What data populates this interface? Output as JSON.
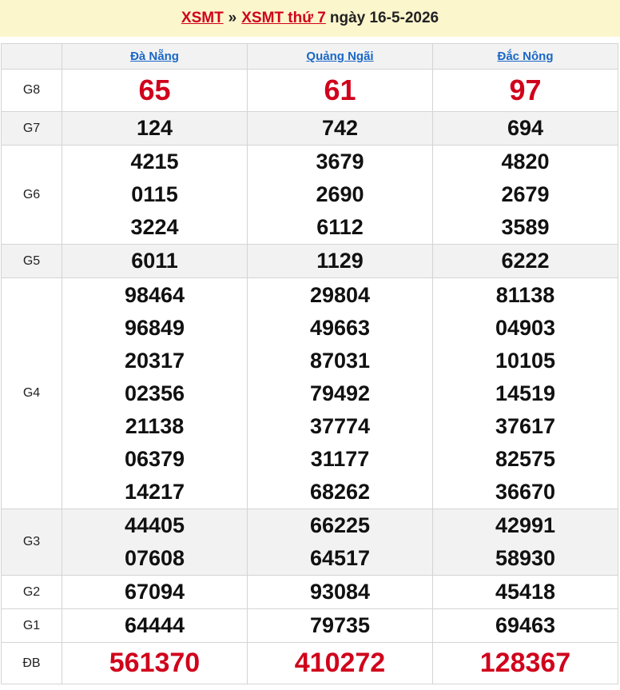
{
  "header": {
    "link_xsmt": "XSMT",
    "separator": "»",
    "link_xsmt_day": "XSMT thứ 7",
    "date_text": "ngày 16-5-2026"
  },
  "provinces": [
    "Đà Nẵng",
    "Quảng Ngãi",
    "Đắc Nông"
  ],
  "prizes": [
    {
      "label": "G8",
      "values": [
        [
          "65"
        ],
        [
          "61"
        ],
        [
          "97"
        ]
      ]
    },
    {
      "label": "G7",
      "values": [
        [
          "124"
        ],
        [
          "742"
        ],
        [
          "694"
        ]
      ]
    },
    {
      "label": "G6",
      "values": [
        [
          "4215",
          "0115",
          "3224"
        ],
        [
          "3679",
          "2690",
          "6112"
        ],
        [
          "4820",
          "2679",
          "3589"
        ]
      ]
    },
    {
      "label": "G5",
      "values": [
        [
          "6011"
        ],
        [
          "1129"
        ],
        [
          "6222"
        ]
      ]
    },
    {
      "label": "G4",
      "values": [
        [
          "98464",
          "96849",
          "20317",
          "02356",
          "21138",
          "06379",
          "14217"
        ],
        [
          "29804",
          "49663",
          "87031",
          "79492",
          "37774",
          "31177",
          "68262"
        ],
        [
          "81138",
          "04903",
          "10105",
          "14519",
          "37617",
          "82575",
          "36670"
        ]
      ]
    },
    {
      "label": "G3",
      "values": [
        [
          "44405",
          "07608"
        ],
        [
          "66225",
          "64517"
        ],
        [
          "42991",
          "58930"
        ]
      ]
    },
    {
      "label": "G2",
      "values": [
        [
          "67094"
        ],
        [
          "93084"
        ],
        [
          "45418"
        ]
      ]
    },
    {
      "label": "G1",
      "values": [
        [
          "64444"
        ],
        [
          "79735"
        ],
        [
          "69463"
        ]
      ]
    },
    {
      "label": "ĐB",
      "values": [
        [
          "561370"
        ],
        [
          "410272"
        ],
        [
          "128367"
        ]
      ]
    }
  ],
  "colors": {
    "header_bg": "#fcf6cd",
    "accent_red": "#d0021b",
    "link_blue": "#1a67c7",
    "shaded_row": "#f2f2f2"
  }
}
